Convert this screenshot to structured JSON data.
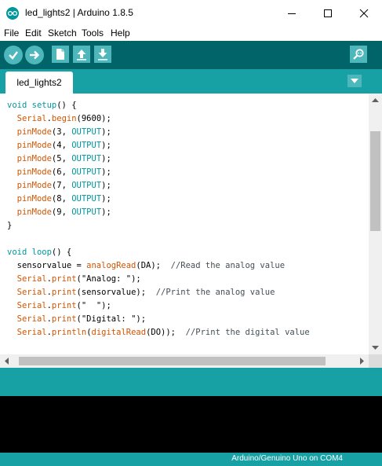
{
  "window": {
    "title": "led_lights2 | Arduino 1.8.5",
    "controls": [
      "minimize-icon",
      "maximize-icon",
      "close-icon"
    ]
  },
  "menu": {
    "file": "File",
    "edit": "Edit",
    "sketch": "Sketch",
    "tools": "Tools",
    "help": "Help"
  },
  "toolbar": {
    "buttons": [
      "verify-icon",
      "upload-icon",
      "new-icon",
      "open-icon",
      "save-icon"
    ],
    "right": "serial-monitor-icon"
  },
  "tab": {
    "label": "led_lights2"
  },
  "code": [
    [
      [
        "kw",
        "void"
      ],
      [
        "plain",
        " "
      ],
      [
        "kw",
        "setup"
      ],
      [
        "plain",
        "() {"
      ]
    ],
    [
      [
        "plain",
        "  "
      ],
      [
        "fn",
        "Serial"
      ],
      [
        "plain",
        "."
      ],
      [
        "fn",
        "begin"
      ],
      [
        "plain",
        "(9600);"
      ]
    ],
    [
      [
        "plain",
        "  "
      ],
      [
        "fn",
        "pinMode"
      ],
      [
        "plain",
        "(3, "
      ],
      [
        "const",
        "OUTPUT"
      ],
      [
        "plain",
        ");"
      ]
    ],
    [
      [
        "plain",
        "  "
      ],
      [
        "fn",
        "pinMode"
      ],
      [
        "plain",
        "(4, "
      ],
      [
        "const",
        "OUTPUT"
      ],
      [
        "plain",
        ");"
      ]
    ],
    [
      [
        "plain",
        "  "
      ],
      [
        "fn",
        "pinMode"
      ],
      [
        "plain",
        "(5, "
      ],
      [
        "const",
        "OUTPUT"
      ],
      [
        "plain",
        ");"
      ]
    ],
    [
      [
        "plain",
        "  "
      ],
      [
        "fn",
        "pinMode"
      ],
      [
        "plain",
        "(6, "
      ],
      [
        "const",
        "OUTPUT"
      ],
      [
        "plain",
        ");"
      ]
    ],
    [
      [
        "plain",
        "  "
      ],
      [
        "fn",
        "pinMode"
      ],
      [
        "plain",
        "(7, "
      ],
      [
        "const",
        "OUTPUT"
      ],
      [
        "plain",
        ");"
      ]
    ],
    [
      [
        "plain",
        "  "
      ],
      [
        "fn",
        "pinMode"
      ],
      [
        "plain",
        "(8, "
      ],
      [
        "const",
        "OUTPUT"
      ],
      [
        "plain",
        ");"
      ]
    ],
    [
      [
        "plain",
        "  "
      ],
      [
        "fn",
        "pinMode"
      ],
      [
        "plain",
        "(9, "
      ],
      [
        "const",
        "OUTPUT"
      ],
      [
        "plain",
        ");"
      ]
    ],
    [
      [
        "plain",
        "}"
      ]
    ],
    [],
    [
      [
        "kw",
        "void"
      ],
      [
        "plain",
        " "
      ],
      [
        "kw",
        "loop"
      ],
      [
        "plain",
        "() {"
      ]
    ],
    [
      [
        "plain",
        "  sensorvalue = "
      ],
      [
        "fn",
        "analogRead"
      ],
      [
        "plain",
        "(DA);  "
      ],
      [
        "cmt",
        "//Read the analog value"
      ]
    ],
    [
      [
        "plain",
        "  "
      ],
      [
        "fn",
        "Serial"
      ],
      [
        "plain",
        "."
      ],
      [
        "fn",
        "print"
      ],
      [
        "plain",
        "(\"Analog: \");"
      ]
    ],
    [
      [
        "plain",
        "  "
      ],
      [
        "fn",
        "Serial"
      ],
      [
        "plain",
        "."
      ],
      [
        "fn",
        "print"
      ],
      [
        "plain",
        "(sensorvalue);  "
      ],
      [
        "cmt",
        "//Print the analog value"
      ]
    ],
    [
      [
        "plain",
        "  "
      ],
      [
        "fn",
        "Serial"
      ],
      [
        "plain",
        "."
      ],
      [
        "fn",
        "print"
      ],
      [
        "plain",
        "(\"  \");"
      ]
    ],
    [
      [
        "plain",
        "  "
      ],
      [
        "fn",
        "Serial"
      ],
      [
        "plain",
        "."
      ],
      [
        "fn",
        "print"
      ],
      [
        "plain",
        "(\"Digital: \");"
      ]
    ],
    [
      [
        "plain",
        "  "
      ],
      [
        "fn",
        "Serial"
      ],
      [
        "plain",
        "."
      ],
      [
        "fn",
        "println"
      ],
      [
        "plain",
        "("
      ],
      [
        "fn",
        "digitalRead"
      ],
      [
        "plain",
        "(DO));  "
      ],
      [
        "cmt",
        "//Print the digital value"
      ]
    ]
  ],
  "footer": {
    "board": "Arduino/Genuino Uno on COM4"
  },
  "colors": {
    "toolbar": "#006468",
    "accent": "#17a1a5",
    "button": "#4db7bb",
    "keyword": "#00979c",
    "function": "#d35400",
    "comment": "#434f54"
  }
}
